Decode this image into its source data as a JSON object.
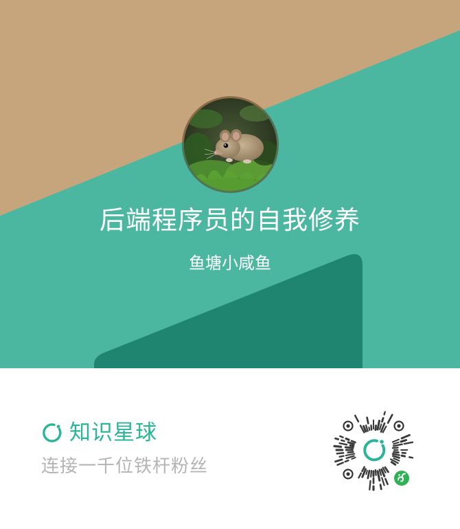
{
  "profile": {
    "title": "后端程序员的自我修养",
    "author": "鱼塘小咸鱼",
    "avatar_icon": "mouse-photo"
  },
  "footer": {
    "brand_name": "知识星球",
    "brand_icon": "planet-ring-icon",
    "tagline": "连接一千位铁杆粉丝",
    "qr_icon": "mini-program-qr-code",
    "qr_badge_icon": "mini-program-badge-icon"
  },
  "colors": {
    "tan": "#c6a57d",
    "teal": "#4bb7a0",
    "dark_teal": "#1f8470",
    "brand_green": "#2ab597",
    "tagline_gray": "#b4b4b4"
  }
}
